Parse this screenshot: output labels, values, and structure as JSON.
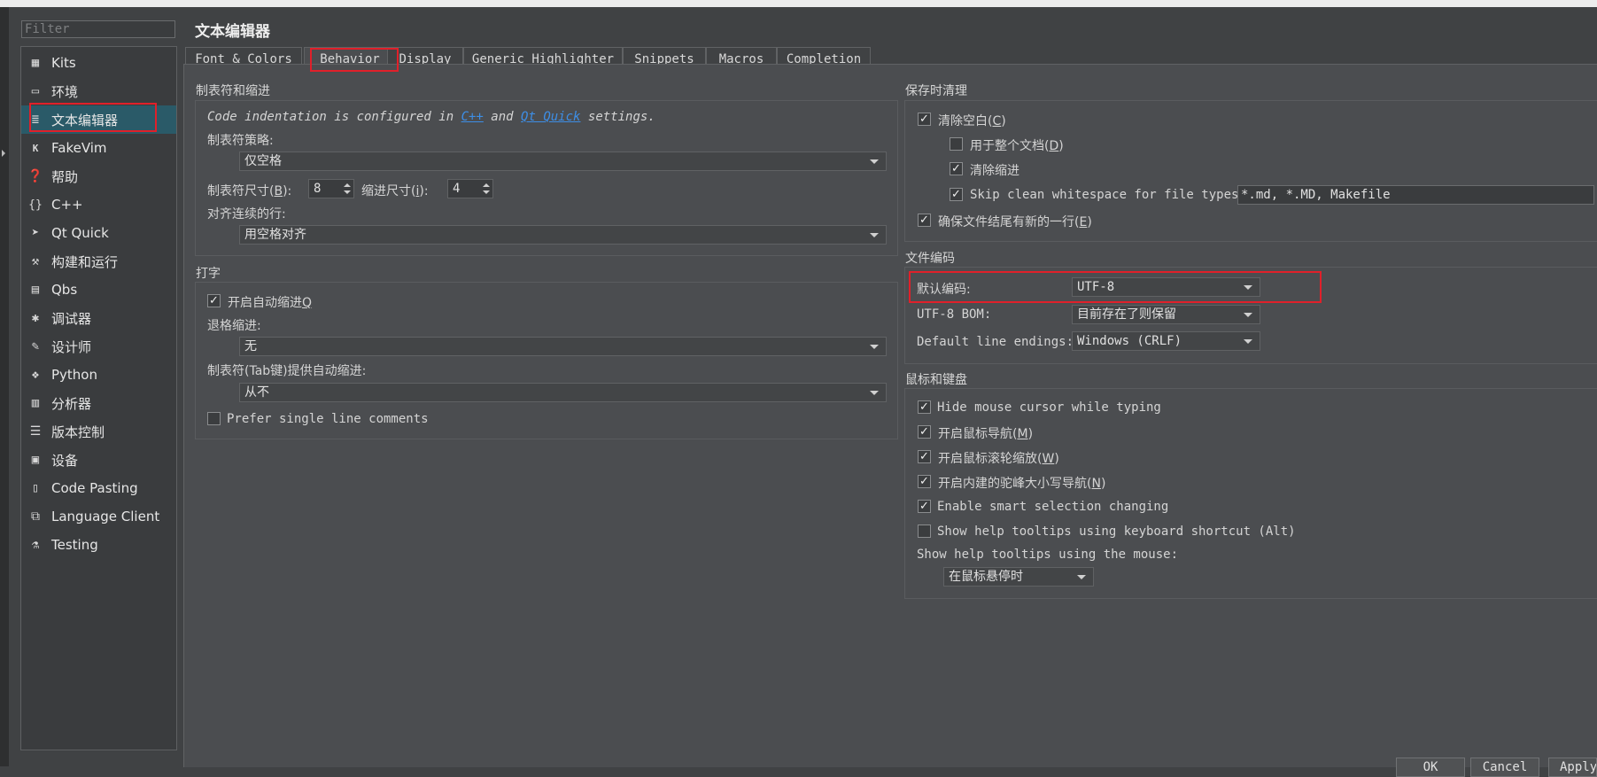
{
  "filter": {
    "placeholder": "Filter"
  },
  "sidebar": {
    "items": [
      {
        "label": "Kits",
        "icon": "kits-icon"
      },
      {
        "label": "环境",
        "icon": "monitor-icon"
      },
      {
        "label": "文本编辑器",
        "icon": "text-editor-icon"
      },
      {
        "label": "FakeVim",
        "icon": "fakevim-icon"
      },
      {
        "label": "帮助",
        "icon": "help-icon"
      },
      {
        "label": "C++",
        "icon": "braces-icon"
      },
      {
        "label": "Qt Quick",
        "icon": "qtquick-icon"
      },
      {
        "label": "构建和运行",
        "icon": "hammer-icon"
      },
      {
        "label": "Qbs",
        "icon": "qbs-icon"
      },
      {
        "label": "调试器",
        "icon": "bug-icon"
      },
      {
        "label": "设计师",
        "icon": "pencil-icon"
      },
      {
        "label": "Python",
        "icon": "python-icon"
      },
      {
        "label": "分析器",
        "icon": "analyzer-icon"
      },
      {
        "label": "版本控制",
        "icon": "version-control-icon"
      },
      {
        "label": "设备",
        "icon": "device-icon"
      },
      {
        "label": "Code Pasting",
        "icon": "clipboard-icon"
      },
      {
        "label": "Language Client",
        "icon": "language-client-icon"
      },
      {
        "label": "Testing",
        "icon": "flask-icon"
      }
    ]
  },
  "page_title": "文本编辑器",
  "tabs": [
    "Font & Colors",
    "Behavior",
    "Display",
    "Generic Highlighter",
    "Snippets",
    "Macros",
    "Completion"
  ],
  "tabs_indent": {
    "header": "制表符和缩进",
    "info_prefix": "Code indentation is configured in ",
    "link_cpp": "C++",
    "info_and": " and ",
    "link_qtquick": "Qt Quick",
    "info_suffix": " settings.",
    "tab_policy_label": "制表符策略:",
    "tab_policy_value": "仅空格",
    "tab_size_label": "制表符尺寸(",
    "tab_size_key": "B",
    "tab_size_close": "):",
    "tab_size_value": "8",
    "indent_size_label": "缩进尺寸(",
    "indent_size_key": "i",
    "indent_size_close": "):",
    "indent_size_value": "4",
    "align_label": "对齐连续的行:",
    "align_value": "用空格对齐"
  },
  "typing": {
    "header": "打字",
    "auto_indent_label": "开启自动缩进",
    "auto_indent_key": "Q",
    "auto_indent_checked": true,
    "backspace_label": "退格缩进:",
    "backspace_value": "无",
    "tab_key_label": "制表符(Tab键)提供自动缩进:",
    "tab_key_value": "从不",
    "single_line_label": "Prefer single line comments",
    "single_line_checked": false
  },
  "cleanup": {
    "header": "保存时清理",
    "clean_ws_label": "清除空白(",
    "clean_ws_key": "C",
    "clean_ws_close": ")",
    "clean_ws_checked": true,
    "whole_doc_label": "用于整个文档(",
    "whole_doc_key": "D",
    "whole_doc_close": ")",
    "whole_doc_checked": false,
    "clean_indent_label": "清除缩进",
    "clean_indent_checked": true,
    "skip_label": "Skip clean whitespace for file types:",
    "skip_checked": true,
    "skip_value": "*.md, *.MD, Makefile",
    "newline_label": "确保文件结尾有新的一行(",
    "newline_key": "E",
    "newline_close": ")",
    "newline_checked": true
  },
  "encoding": {
    "header": "文件编码",
    "default_label": "默认编码:",
    "default_value": "UTF-8",
    "bom_label": "UTF-8 BOM:",
    "bom_value": "目前存在了则保留",
    "line_endings_label": "Default line endings:",
    "line_endings_value": "Windows (CRLF)"
  },
  "mouse": {
    "header": "鼠标和键盘",
    "hide_cursor_label": "Hide mouse cursor while typing",
    "hide_cursor_checked": true,
    "mouse_nav_label": "开启鼠标导航(",
    "mouse_nav_key": "M",
    "mouse_nav_close": ")",
    "mouse_nav_checked": true,
    "wheel_zoom_label": "开启鼠标滚轮缩放(",
    "wheel_zoom_key": "W",
    "wheel_zoom_close": ")",
    "wheel_zoom_checked": true,
    "camel_label": "开启内建的驼峰大小写导航(",
    "camel_key": "N",
    "camel_close": ")",
    "camel_checked": true,
    "smart_sel_label": "Enable smart selection changing",
    "smart_sel_checked": true,
    "kbd_tooltips_label": "Show help tooltips using keyboard shortcut (Alt)",
    "kbd_tooltips_checked": false,
    "mouse_tooltips_label": "Show help tooltips using the mouse:",
    "mouse_tooltips_value": "在鼠标悬停时"
  },
  "buttons": {
    "ok": "OK",
    "cancel": "Cancel",
    "apply": "Apply"
  },
  "colors": {
    "accent_selection": "#2a5a68",
    "annotation_red": "#e0202a",
    "link": "#3d8ee6"
  }
}
